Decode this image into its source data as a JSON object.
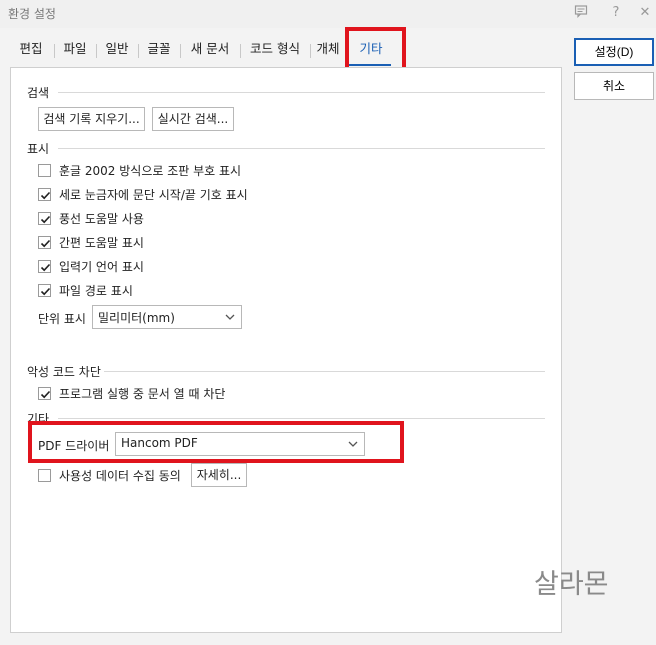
{
  "window": {
    "title": "환경 설정",
    "icons": [
      "message-icon",
      "help-icon",
      "close-icon"
    ],
    "help_glyph": "?",
    "close_glyph": "✕"
  },
  "tabs": [
    {
      "label": "편집"
    },
    {
      "label": "파일"
    },
    {
      "label": "일반"
    },
    {
      "label": "글꼴"
    },
    {
      "label": "새 문서"
    },
    {
      "label": "코드 형식"
    },
    {
      "label": "개체"
    },
    {
      "label": "기타",
      "active": true
    }
  ],
  "sections": {
    "search": {
      "title": "검색",
      "clear_history_button": "검색 기록 지우기...",
      "realtime_search_button": "실시간 검색..."
    },
    "display": {
      "title": "표시",
      "options": [
        {
          "label": "훈글 2002 방식으로 조판 부호 표시",
          "checked": false
        },
        {
          "label": "세로 눈금자에 문단 시작/끝 기호 표시",
          "checked": true
        },
        {
          "label": "풍선 도움말 사용",
          "checked": true
        },
        {
          "label": "간편 도움말 표시",
          "checked": true
        },
        {
          "label": "입력기 언어 표시",
          "checked": true
        },
        {
          "label": "파일 경로 표시",
          "checked": true
        }
      ],
      "unit_label": "단위 표시",
      "unit_value": "밀리미터(mm)"
    },
    "malware": {
      "title": "악성 코드 차단",
      "block_label": "프로그램 실행 중 문서 열 때 차단",
      "block_checked": true
    },
    "etc": {
      "title": "기타",
      "pdf_driver_label": "PDF 드라이버",
      "pdf_driver_value": "Hancom PDF",
      "usage_data_label": "사용성 데이터 수집 동의",
      "usage_data_checked": false,
      "details_button": "자세히..."
    }
  },
  "side_buttons": {
    "ok": "설정(D)",
    "cancel": "취소"
  },
  "watermark": "살라몬",
  "colors": {
    "accent": "#1a5fb4",
    "highlight": "#e0141d"
  }
}
